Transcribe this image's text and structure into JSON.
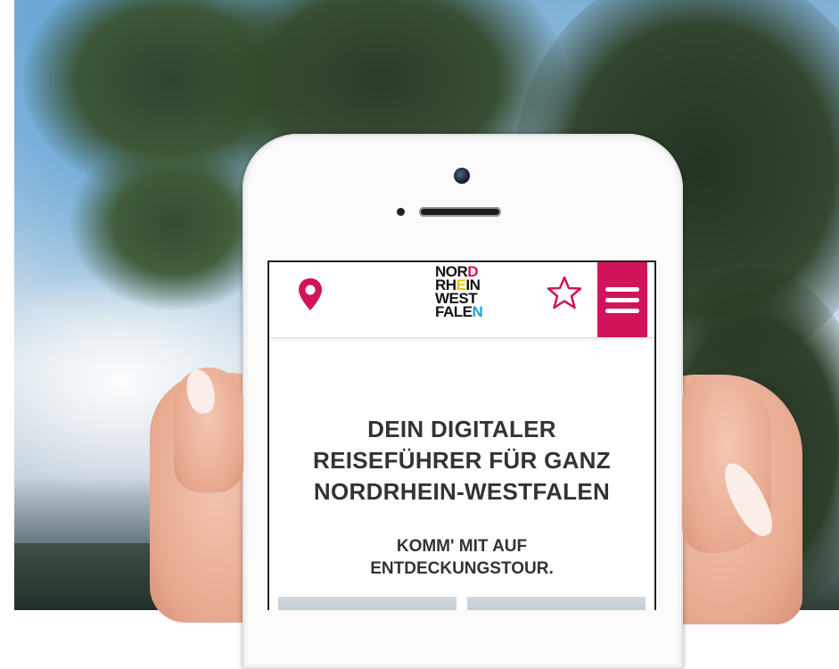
{
  "logo": {
    "line1": [
      "NOR",
      "D"
    ],
    "line2": [
      "RH",
      "E",
      "IN"
    ],
    "line3": [
      "WEST"
    ],
    "line4": [
      "FALE",
      "N"
    ]
  },
  "header": {
    "location_icon": "map-pin-icon",
    "favorite_icon": "star-outline-icon",
    "menu_icon": "hamburger-menu-icon",
    "accent_color": "#d1145a"
  },
  "main": {
    "headline_lines": [
      "DEIN DIGITALER",
      "REISEFÜHRER FÜR GANZ",
      "NORDRHEIN-WESTFALEN"
    ],
    "subline_lines": [
      "KOMM' MIT AUF",
      "ENTDECKUNGSTOUR."
    ]
  }
}
